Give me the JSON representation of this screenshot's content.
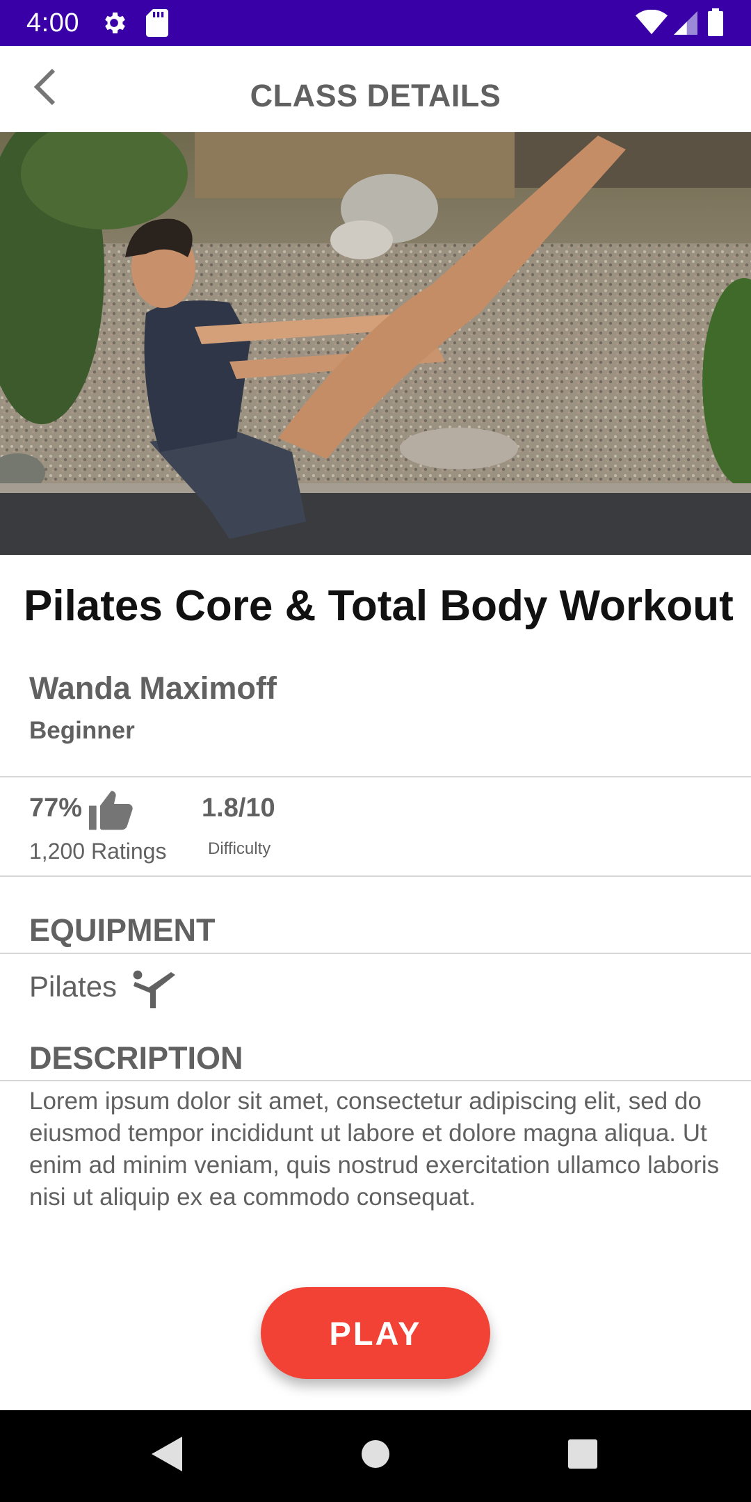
{
  "status_bar": {
    "time": "4:00",
    "icons": [
      "gear-icon",
      "sd-card-icon",
      "wifi-icon",
      "signal-icon",
      "battery-icon"
    ],
    "background": "#3a00a8"
  },
  "header": {
    "title": "CLASS DETAILS",
    "back_icon": "chevron-left-icon"
  },
  "class": {
    "title": "Pilates Core & Total Body Workout",
    "instructor": "Wanda Maximoff",
    "level": "Beginner",
    "rating_percent": "77%",
    "rating_icon": "thumbs-up-icon",
    "rating_count": "1,200 Ratings",
    "difficulty_value": "1.8/10",
    "difficulty_label": "Difficulty"
  },
  "equipment": {
    "heading": "EQUIPMENT",
    "item": "Pilates",
    "item_icon": "pilates-pose-icon"
  },
  "description": {
    "heading": "DESCRIPTION",
    "text": "Lorem ipsum dolor sit amet, consectetur adipiscing elit, sed do eiusmod tempor incididunt ut labore et dolore magna aliqua. Ut enim ad minim veniam, quis nostrud exercitation ullamco laboris nisi ut aliquip ex ea commodo consequat."
  },
  "play_button": {
    "label": "PLAY",
    "color": "#f24236"
  },
  "nav_bar": {
    "buttons": [
      "back-triangle-icon",
      "home-circle-icon",
      "recents-square-icon"
    ]
  }
}
